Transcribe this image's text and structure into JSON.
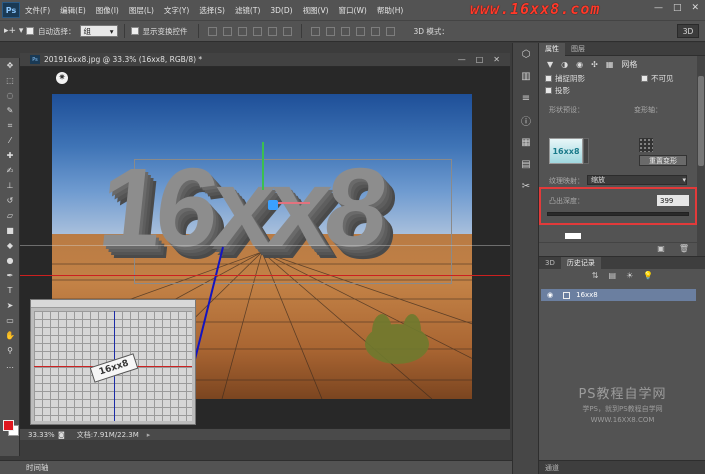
{
  "menubar": {
    "logo": "Ps",
    "items": [
      "文件(F)",
      "编辑(E)",
      "图像(I)",
      "图层(L)",
      "文字(Y)",
      "选择(S)",
      "滤镜(T)",
      "3D(D)",
      "视图(V)",
      "窗口(W)",
      "帮助(H)"
    ],
    "watermark": "www.16xx8.com",
    "window_controls": [
      "—",
      "□",
      "✕"
    ]
  },
  "optbar": {
    "auto_select_label": "自动选择：",
    "auto_select_value": "组",
    "show_transform_label": "显示变换控件",
    "mode_label": "3D 模式：",
    "btn_3d": "3D"
  },
  "document": {
    "title": "201916xx8.jpg @ 33.3% (16xx8, RGB/8) *",
    "text3d": "16xx8",
    "mini_text": "16xx8",
    "zoom": "33.33%",
    "doc_info": "文档:7.91M/22.3M"
  },
  "timeline": {
    "label": "时间轴"
  },
  "properties": {
    "tab_active": "属性",
    "tab_other": "图层",
    "mesh_label": "网格",
    "catch_shadow": "捕捉阴影",
    "invisible": "不可见",
    "cast_shadow": "投影",
    "preset_label": "形状预设：",
    "warp_label": "变形轴：",
    "reset_button": "重置变形",
    "texture_label": "纹理映射：",
    "texture_value": "缩放",
    "extrude_label": "凸出深度：",
    "extrude_value": "399",
    "preset_text": "16xx8"
  },
  "history": {
    "tab_3d": "3D",
    "tab_history": "历史记录",
    "item": "16xx8"
  },
  "channels": {
    "label": "通道"
  },
  "right_watermark": {
    "title": "PS教程自学网",
    "line1": "学PS，就到PS教程自学网",
    "line2": "WWW.16XX8.COM"
  },
  "colors": {
    "foreground": "#e0161e",
    "background": "#ffffff",
    "highlight": "#e23a3a"
  }
}
